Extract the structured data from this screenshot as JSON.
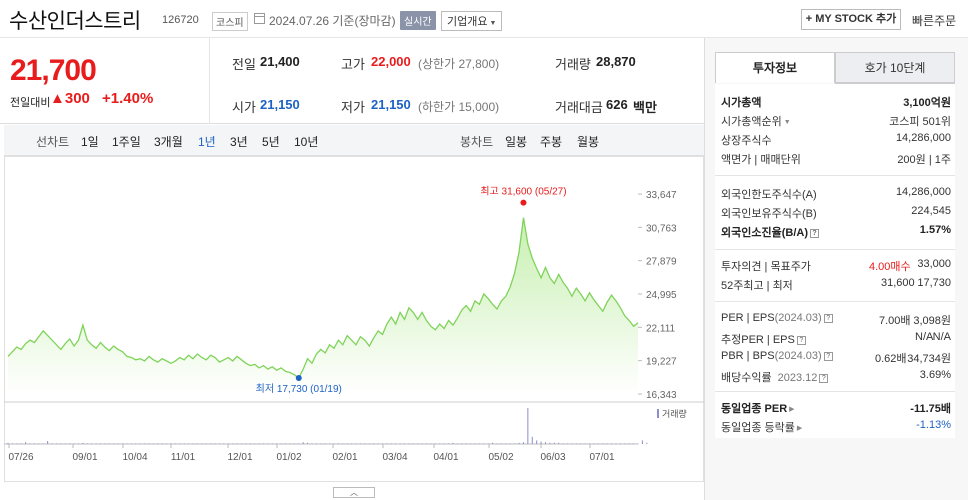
{
  "header": {
    "stock_name": "수산인더스트리",
    "stock_code": "126720",
    "market": "코스피",
    "date": "2024.07.26 기준(장마감)",
    "realtime": "실시간",
    "company_info": "기업개요",
    "mystock": "MY STOCK 추가",
    "quick_order": "빠른주문"
  },
  "price": {
    "current": "21,700",
    "change_label": "전일대비",
    "change": "300",
    "change_pct": "+1.40%"
  },
  "quote": {
    "prev_label": "전일",
    "prev": "21,400",
    "high_label": "고가",
    "high": "22,000",
    "upper_limit": "(상한가 27,800)",
    "volume_label": "거래량",
    "volume": "28,870",
    "open_label": "시가",
    "open": "21,150",
    "low_label": "저가",
    "low": "21,150",
    "lower_limit": "(하한가 15,000)",
    "amount_label": "거래대금",
    "amount": "626",
    "amount_unit": "백만"
  },
  "toolbar": {
    "line_label": "선차트",
    "line_items": [
      "1일",
      "1주일",
      "3개월",
      "1년",
      "3년",
      "5년",
      "10년"
    ],
    "candle_label": "봉차트",
    "candle_items": [
      "일봉",
      "주봉",
      "월봉"
    ]
  },
  "chart_data": {
    "type": "area",
    "y_ticks": [
      "33,647",
      "30,763",
      "27,879",
      "24,995",
      "22,111",
      "19,227",
      "16,343"
    ],
    "ylim": [
      16343,
      33647
    ],
    "x_labels": [
      "07/26",
      "09/01",
      "10/04",
      "11/01",
      "12/01",
      "01/02",
      "02/01",
      "03/04",
      "04/01",
      "05/02",
      "06/03",
      "07/01"
    ],
    "high_annotation": "최고 31,600 (05/27)",
    "low_annotation": "최저 17,730 (01/19)",
    "volume_label": "거래량",
    "colors": {
      "line": "#7fd35a",
      "fill_top": "#c7efb0",
      "high": "#e81c1c",
      "low": "#1d62c4"
    },
    "values": [
      19600,
      20000,
      20400,
      20200,
      20700,
      21000,
      20800,
      21300,
      21800,
      21400,
      21000,
      20600,
      20200,
      20700,
      21100,
      20500,
      21000,
      22300,
      21000,
      20600,
      20300,
      20800,
      20400,
      20100,
      20500,
      20200,
      20000,
      19600,
      19500,
      19300,
      19400,
      19200,
      19600,
      19300,
      19100,
      19400,
      19200,
      19000,
      19200,
      19500,
      19300,
      19700,
      19400,
      19800,
      19500,
      19300,
      19700,
      19500,
      19100,
      19300,
      19500,
      19200,
      19600,
      19300,
      19000,
      18800,
      18900,
      18600,
      18800,
      18500,
      18700,
      18400,
      18600,
      18300,
      18200,
      18000,
      17730,
      18500,
      19400,
      19000,
      19800,
      20200,
      19900,
      20600,
      20300,
      21000,
      20600,
      21400,
      21000,
      20600,
      21300,
      21000,
      20500,
      21200,
      21800,
      21500,
      22400,
      23000,
      22400,
      23400,
      22800,
      23800,
      23400,
      22800,
      23400,
      22700,
      22200,
      21900,
      22400,
      22000,
      22700,
      22300,
      22900,
      23600,
      24000,
      23500,
      24400,
      24100,
      25000,
      24600,
      24100,
      23700,
      24400,
      24800,
      25600,
      26800,
      28600,
      31600,
      29300,
      28100,
      27200,
      26400,
      27300,
      26400,
      25900,
      26700,
      26000,
      25500,
      24800,
      25500,
      25000,
      24400,
      25100,
      24500,
      24000,
      23500,
      24300,
      24900,
      24400,
      23800,
      23100,
      22700,
      22200,
      22500
    ],
    "volume": [
      2,
      1,
      1,
      1,
      3,
      1,
      1,
      1,
      1,
      5,
      1,
      1,
      1,
      1,
      1,
      1,
      1,
      2,
      1,
      1,
      1,
      1,
      1,
      1,
      1,
      1,
      1,
      1,
      1,
      1,
      1,
      1,
      1,
      1,
      1,
      1,
      1,
      1,
      1,
      1,
      1,
      1,
      1,
      1,
      1,
      1,
      1,
      1,
      1,
      1,
      1,
      1,
      1,
      1,
      1,
      1,
      1,
      1,
      1,
      1,
      1,
      1,
      1,
      1,
      1,
      1,
      1,
      3,
      2,
      1,
      1,
      1,
      1,
      1,
      1,
      1,
      1,
      1,
      1,
      1,
      1,
      1,
      1,
      1,
      1,
      1,
      1,
      1,
      1,
      1,
      1,
      1,
      1,
      1,
      1,
      1,
      1,
      1,
      1,
      1,
      1,
      2,
      1,
      1,
      1,
      1,
      1,
      1,
      1,
      1,
      2,
      1,
      1,
      1,
      1,
      1,
      2,
      3,
      60,
      12,
      6,
      4,
      3,
      2,
      2,
      2,
      1,
      1,
      1,
      1,
      1,
      1,
      1,
      1,
      1,
      1,
      1,
      1,
      1,
      1,
      1,
      1,
      1,
      1,
      6,
      2
    ]
  },
  "right": {
    "tab_active": "투자정보",
    "tab_inactive": "호가 10단계",
    "s1": {
      "mcap_label": "시가총액",
      "mcap": "3,100억원",
      "rank_label": "시가총액순위",
      "rank": "코스피 501위",
      "shares_label": "상장주식수",
      "shares": "14,286,000",
      "par_label": "액면가 | 매매단위",
      "par": "200원 | 1주"
    },
    "s2": {
      "foreign_limit_label": "외국인한도주식수(A)",
      "foreign_limit": "14,286,000",
      "foreign_hold_label": "외국인보유주식수(B)",
      "foreign_hold": "224,545",
      "foreign_ratio_label": "외국인소진율(B/A)",
      "foreign_ratio": "1.57%"
    },
    "s3": {
      "opinion_label": "투자의견 | 목표주가",
      "opinion": "4.00매수",
      "target": "33,000",
      "range_label": "52주최고 | 최저",
      "high52": "31,600",
      "low52": "17,730"
    },
    "s4": {
      "per_label": "PER | EPS",
      "per_date": "(2024.03)",
      "per": "7.00배",
      "eps": "3,098원",
      "eper_label": "추정PER | EPS",
      "eper": "N/A",
      "eeps": "N/A",
      "pbr_label": "PBR | BPS",
      "pbr_date": "(2024.03)",
      "pbr": "0.62배",
      "bps": "34,734원",
      "div_label": "배당수익률",
      "div_date": "2023.12",
      "div": "3.69%"
    },
    "s5": {
      "sector_per_label": "동일업종 PER",
      "sector_per": "-11.75배",
      "sector_chg_label": "동일업종 등락률",
      "sector_chg": "-1.13%"
    }
  }
}
